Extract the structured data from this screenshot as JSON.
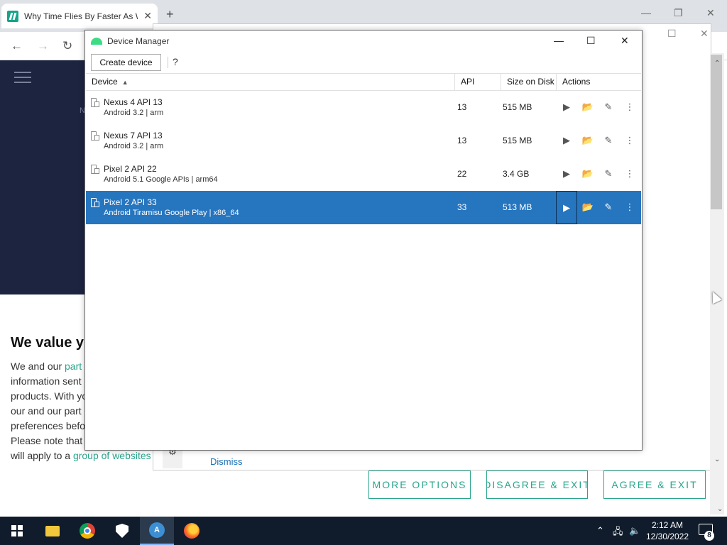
{
  "browser": {
    "tab_title": "Why Time Flies By Faster As We",
    "tab_close": "✕",
    "new_tab": "+",
    "window_controls": {
      "minimize": "—",
      "restore": "❐",
      "close": "✕"
    },
    "nav": {
      "back": "←",
      "forward": "→",
      "reload": "↻"
    }
  },
  "site": {
    "header_letter": "N",
    "consent_heading": "We value y",
    "consent_lines": [
      {
        "before": "We and our ",
        "link": "part",
        "after": ""
      },
      {
        "before": "information sent",
        "link": "",
        "after": ""
      },
      {
        "before": "products. With yo",
        "link": "",
        "after": ""
      },
      {
        "before": "our and our part",
        "link": "",
        "after": ""
      },
      {
        "before": "preferences befo",
        "link": "",
        "after": ""
      },
      {
        "before": "Please note that",
        "link": "",
        "after": ""
      },
      {
        "before": "will apply to a ",
        "link": "group of websites",
        "after": ""
      }
    ],
    "popup_controls": {
      "restore": "☐",
      "close": "✕"
    },
    "dismiss": "Dismiss",
    "gear": "⚙",
    "buttons": {
      "more_options": "MORE OPTIONS",
      "disagree": "DISAGREE & EXIT",
      "agree": "AGREE & EXIT"
    },
    "scroll_up": "⌃",
    "scroll_down": "⌄"
  },
  "device_manager": {
    "title": "Device Manager",
    "window_controls": {
      "minimize": "—",
      "maximize": "☐",
      "close": "✕"
    },
    "toolbar": {
      "create_device": "Create device",
      "help": "?"
    },
    "columns": {
      "device": "Device",
      "sort_indicator": "▲",
      "api": "API",
      "size": "Size on Disk",
      "actions": "Actions"
    },
    "rows": [
      {
        "name": "Nexus 4 API 13",
        "subtitle": "Android 3.2 | arm",
        "api": "13",
        "size": "515 MB",
        "selected": false
      },
      {
        "name": "Nexus 7 API 13",
        "subtitle": "Android 3.2 | arm",
        "api": "13",
        "size": "515 MB",
        "selected": false
      },
      {
        "name": "Pixel 2 API 22",
        "subtitle": "Android 5.1 Google APIs | arm64",
        "api": "22",
        "size": "3.4 GB",
        "selected": false
      },
      {
        "name": "Pixel 2 API 33",
        "subtitle": "Android Tiramisu Google Play | x86_64",
        "api": "33",
        "size": "513 MB",
        "selected": true
      }
    ],
    "action_icons": {
      "launch": "▶",
      "folder": "📂",
      "edit": "✎",
      "more": "⋮"
    }
  },
  "taskbar": {
    "clock_time": "2:12 AM",
    "clock_date": "12/30/2022",
    "tray": {
      "chevron": "⌃",
      "network": "🖧",
      "volume": "🔈"
    },
    "notification_count": "8",
    "studio_icon_letter": "A"
  }
}
